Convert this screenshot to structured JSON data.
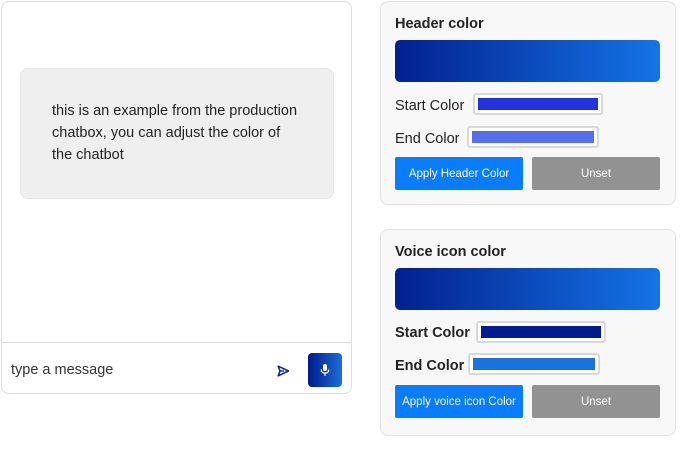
{
  "chat": {
    "message": "this is an example from the production chatbox, you can adjust the color of the chatbot",
    "input_placeholder": "type a message",
    "send_icon": "send-icon",
    "mic_icon": "microphone-icon"
  },
  "header_card": {
    "title": "Header color",
    "start_label": "Start Color",
    "end_label": "End Color",
    "start_color": "#2233dd",
    "end_color": "#5570ee",
    "preview_from": "#03208f",
    "preview_to": "#1474e6",
    "apply_label": "Apply Header Color",
    "unset_label": "Unset"
  },
  "voice_card": {
    "title": "Voice icon color",
    "start_label": "Start Color",
    "end_label": "End Color",
    "start_color": "#001b8c",
    "end_color": "#1a72dc",
    "preview_from": "#03208f",
    "preview_to": "#1474e6",
    "apply_label": "Apply voice icon Color",
    "unset_label": "Unset"
  },
  "colors": {
    "primary_button": "#0a7cff",
    "secondary_button": "#929292"
  }
}
